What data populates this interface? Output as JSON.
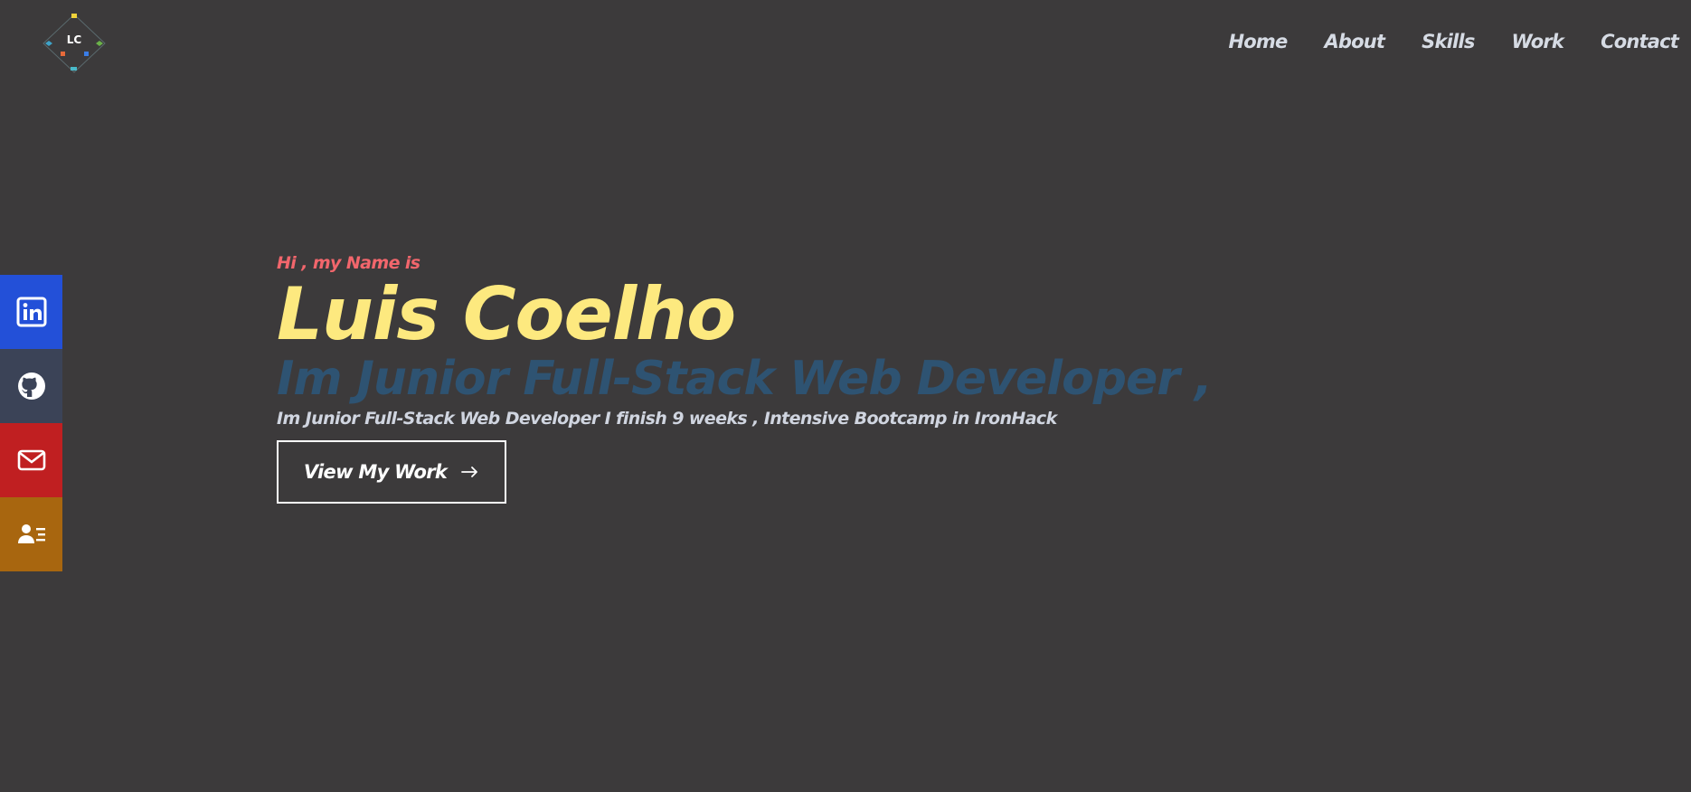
{
  "logo": {
    "text": "LC"
  },
  "nav": {
    "items": [
      {
        "label": "Home"
      },
      {
        "label": "About"
      },
      {
        "label": "Skills"
      },
      {
        "label": "Work"
      },
      {
        "label": "Contact"
      }
    ]
  },
  "social": {
    "items": [
      {
        "icon": "linkedin-icon",
        "color": "#2350d8"
      },
      {
        "icon": "github-icon",
        "color": "#3b4357"
      },
      {
        "icon": "mail-icon",
        "color": "#c01f21"
      },
      {
        "icon": "contact-card-icon",
        "color": "#a8660f"
      }
    ]
  },
  "hero": {
    "intro": "Hi , my Name is",
    "name": "Luis Coelho",
    "role": "Im Junior Full-Stack Web Developer ,",
    "description": "Im Junior Full-Stack Web Developer I finish 9 weeks , Intensive Bootcamp in IronHack",
    "cta_label": "View My Work"
  },
  "colors": {
    "background": "#3c3a3b",
    "intro": "#f2666c",
    "name": "#fde97f",
    "role": "#2e5372",
    "text": "#d0d5e0"
  }
}
